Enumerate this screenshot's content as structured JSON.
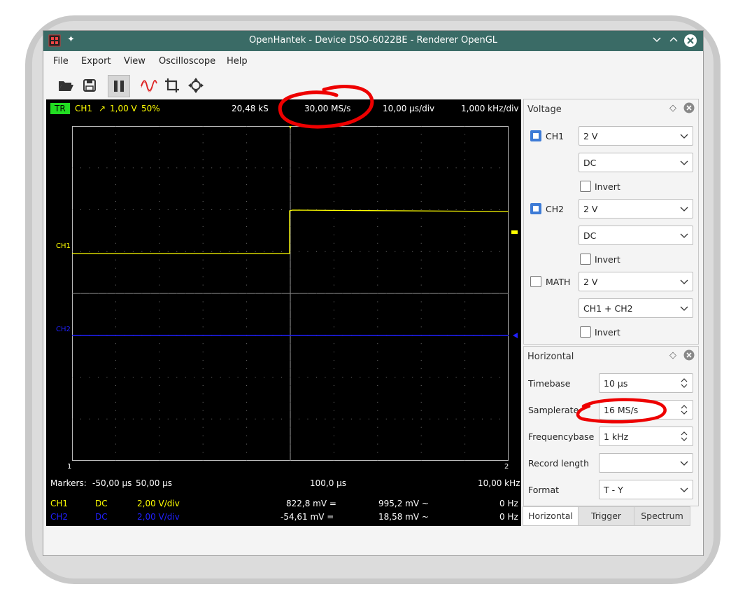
{
  "window": {
    "title": "OpenHantek - Device DSO-6022BE - Renderer OpenGL"
  },
  "menu": [
    "File",
    "Export",
    "View",
    "Oscilloscope",
    "Help"
  ],
  "toolbar": {
    "icons": [
      "open-icon",
      "save-icon",
      "pause-icon",
      "digital-phosphor-icon",
      "zoom-icon",
      "measure-icon"
    ]
  },
  "scope": {
    "status": {
      "trigger_badge": "TR",
      "channel": "CH1",
      "slope": "↗",
      "level": "1,00 V",
      "position": "50%",
      "samples": "20,48 kS",
      "samplerate": "30,00 MS/s",
      "timebase": "10,00 µs/div",
      "frequencybase": "1,000 kHz/div"
    },
    "labels": {
      "ch1": "CH1",
      "ch2": "CH2",
      "marker1": "1",
      "marker2": "2"
    },
    "markers_row": {
      "label": "Markers:",
      "start": "-50,00 µs",
      "end": "50,00 µs",
      "delta": "100,0 µs",
      "freq": "10,00 kHz"
    },
    "channels": [
      {
        "name": "CH1",
        "coupling": "DC",
        "vdiv": "2,00 V/div",
        "dc": "822,8 mV =",
        "ac": "995,2 mV ~",
        "freq": "0 Hz",
        "color": "#ffff00"
      },
      {
        "name": "CH2",
        "coupling": "DC",
        "vdiv": "2,00 V/div",
        "dc": "-54,61 mV =",
        "ac": "18,58 mV ~",
        "freq": "0 Hz",
        "color": "#2020ff"
      }
    ]
  },
  "voltage_dock": {
    "title": "Voltage",
    "ch1": {
      "label": "CH1",
      "checked": true,
      "gain": "2 V",
      "coupling": "DC",
      "invert": "Invert"
    },
    "ch2": {
      "label": "CH2",
      "checked": true,
      "gain": "2 V",
      "coupling": "DC",
      "invert": "Invert"
    },
    "math": {
      "label": "MATH",
      "checked": false,
      "gain": "2 V",
      "mode": "CH1 + CH2",
      "invert": "Invert"
    }
  },
  "horizontal_dock": {
    "title": "Horizontal",
    "timebase": {
      "label": "Timebase",
      "value": "10 µs"
    },
    "samplerate": {
      "label": "Samplerate",
      "value": "16 MS/s"
    },
    "frequencybase": {
      "label": "Frequencybase",
      "value": "1 kHz"
    },
    "record_length": {
      "label": "Record length",
      "value": ""
    },
    "format": {
      "label": "Format",
      "value": "T - Y"
    }
  },
  "tabs": [
    "Horizontal",
    "Trigger",
    "Spectrum"
  ],
  "colors": {
    "titlebar": "#3a6b66",
    "ch1": "#ffff00",
    "ch2": "#2020ff",
    "trigger_badge": "#22dd22",
    "annotation": "#ee0000"
  }
}
